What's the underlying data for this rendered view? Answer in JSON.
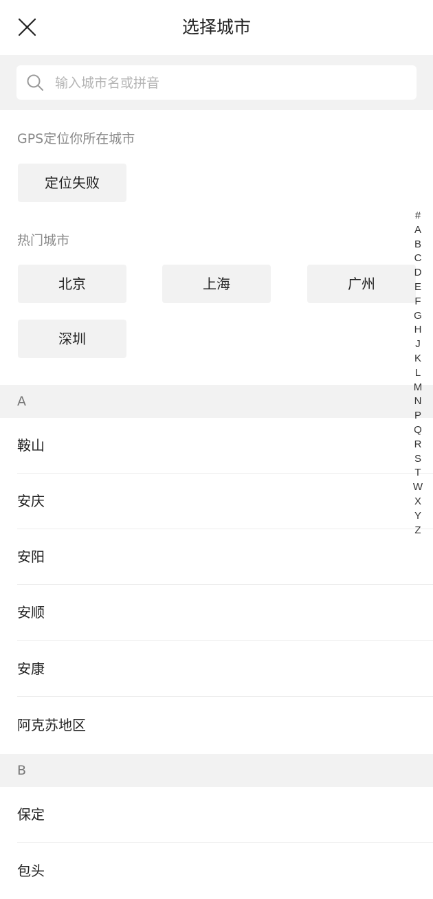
{
  "header": {
    "title": "选择城市"
  },
  "search": {
    "placeholder": "输入城市名或拼音"
  },
  "gps": {
    "label": "GPS定位你所在城市",
    "status": "定位失败"
  },
  "hot": {
    "label": "热门城市",
    "cities": [
      "北京",
      "上海",
      "广州",
      "深圳"
    ]
  },
  "sections": [
    {
      "letter": "A",
      "cities": [
        "鞍山",
        "安庆",
        "安阳",
        "安顺",
        "安康",
        "阿克苏地区"
      ]
    },
    {
      "letter": "B",
      "cities": [
        "保定",
        "包头"
      ]
    }
  ],
  "index_letters": [
    "#",
    "A",
    "B",
    "C",
    "D",
    "E",
    "F",
    "G",
    "H",
    "J",
    "K",
    "L",
    "M",
    "N",
    "P",
    "Q",
    "R",
    "S",
    "T",
    "W",
    "X",
    "Y",
    "Z"
  ],
  "colors": {
    "band": "#f2f2f2",
    "muted_text": "#8a8a8a",
    "text": "#222222"
  }
}
